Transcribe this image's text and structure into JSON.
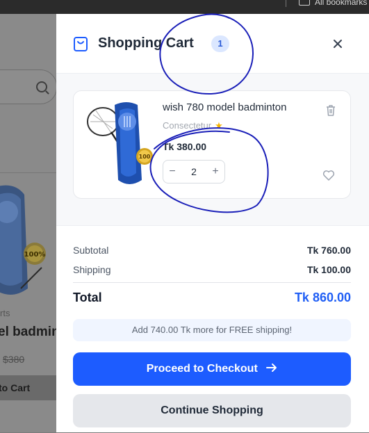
{
  "browser": {
    "bookmarks_label": "All bookmarks"
  },
  "background_page": {
    "category": "rts",
    "product_name": "el badmin",
    "old_price": "$380",
    "add_to_cart": "to Cart"
  },
  "cart": {
    "title": "Shopping Cart",
    "count": "1",
    "item": {
      "name": "wish 780 model badminton",
      "subtitle": "Consectetur",
      "price": "Tk 380.00",
      "quantity": "2"
    },
    "summary": {
      "subtotal_label": "Subtotal",
      "subtotal_value": "Tk 760.00",
      "shipping_label": "Shipping",
      "shipping_value": "Tk 100.00",
      "total_label": "Total",
      "total_value": "Tk 860.00",
      "free_shipping_note": "Add 740.00 Tk more for FREE shipping!"
    },
    "checkout_label": "Proceed to Checkout",
    "continue_label": "Continue Shopping"
  },
  "colors": {
    "accent": "#1d5cff",
    "total_value": "#1f5ef5",
    "badge_bg": "#dbe7ff",
    "annotation_ink": "#1a1fb8"
  },
  "icons": [
    "bag-icon",
    "close-icon",
    "trash-icon",
    "heart-icon",
    "minus-icon",
    "plus-icon",
    "arrow-right-icon",
    "search-icon",
    "bookmark-icon"
  ]
}
